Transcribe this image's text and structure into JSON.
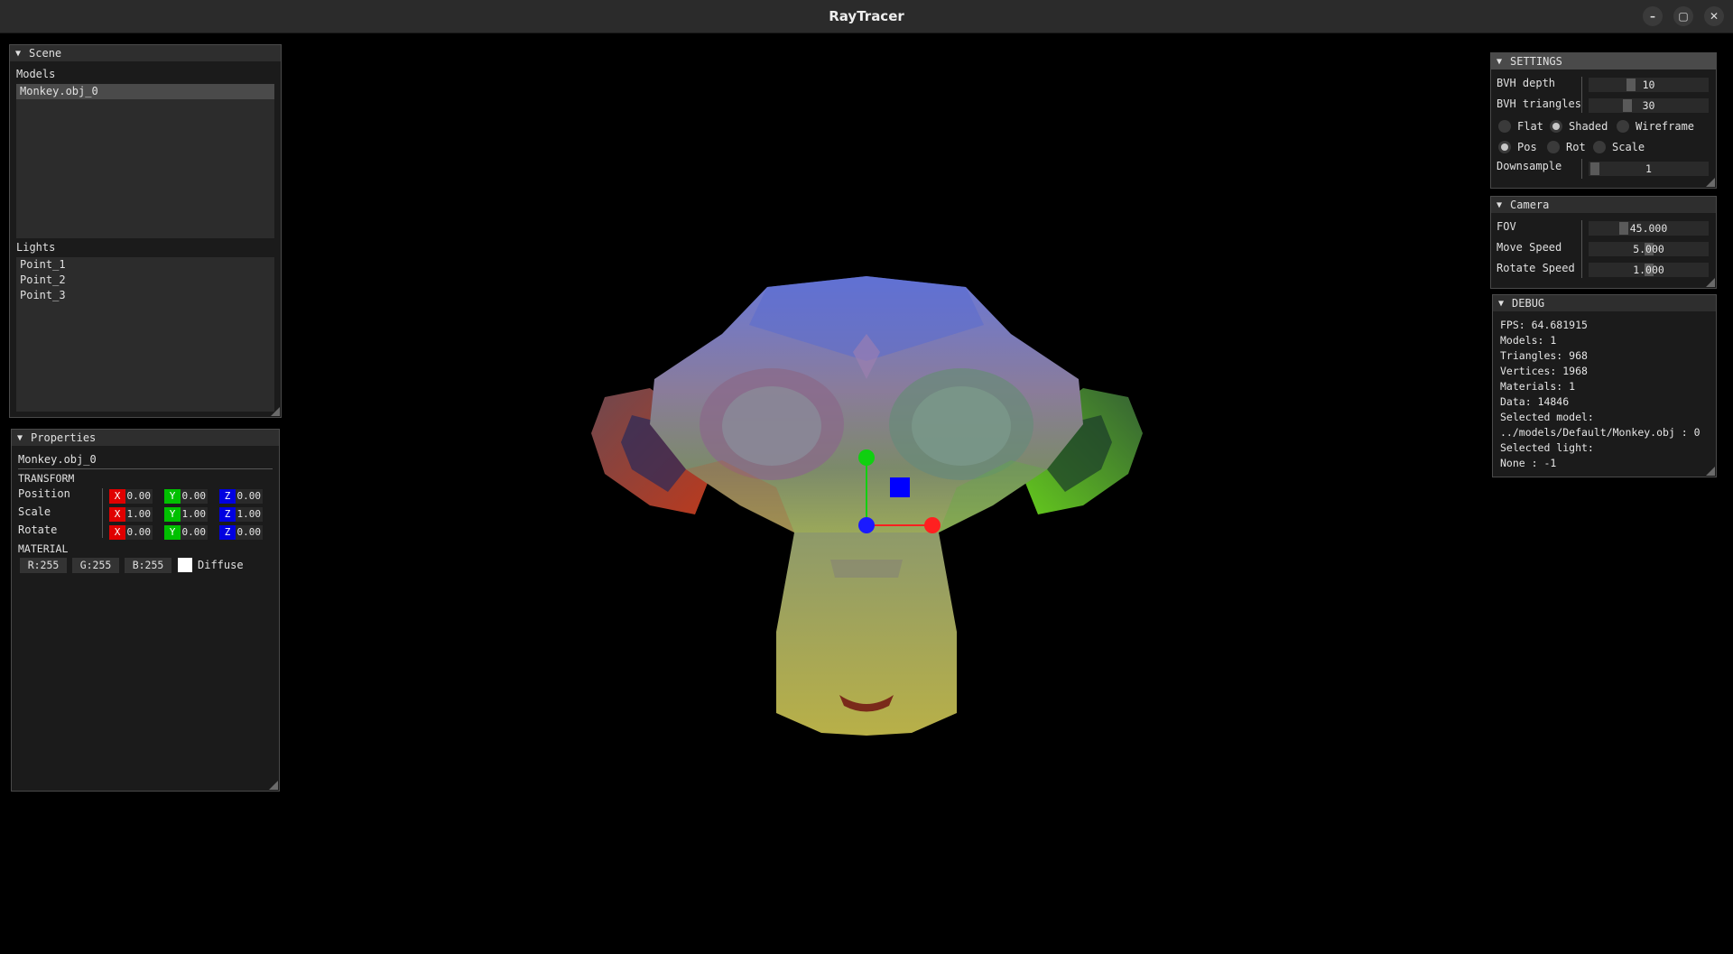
{
  "window": {
    "title": "RayTracer",
    "minimize": "–",
    "maximize": "▢",
    "close": "✕"
  },
  "scene_panel": {
    "title": "Scene",
    "models_label": "Models",
    "models": [
      "Monkey.obj_0"
    ],
    "lights_label": "Lights",
    "lights": [
      "Point_1",
      "Point_2",
      "Point_3"
    ]
  },
  "properties_panel": {
    "title": "Properties",
    "selected_name": "Monkey.obj_0",
    "transform_label": "TRANSFORM",
    "axis_labels": {
      "x": "X",
      "y": "Y",
      "z": "Z"
    },
    "position": {
      "label": "Position",
      "x": "0.00",
      "y": "0.00",
      "z": "0.00"
    },
    "scale": {
      "label": "Scale",
      "x": "1.00",
      "y": "1.00",
      "z": "1.00"
    },
    "rotate": {
      "label": "Rotate",
      "x": "0.00",
      "y": "0.00",
      "z": "0.00"
    },
    "material_label": "MATERIAL",
    "material": {
      "r": "R:255",
      "g": "G:255",
      "b": "B:255",
      "type": "Diffuse",
      "swatch_color": "#ffffff"
    }
  },
  "settings_panel": {
    "title": "SETTINGS",
    "bvh_depth": {
      "label": "BVH depth",
      "value": "10"
    },
    "bvh_triangles": {
      "label": "BVH triangles",
      "value": "30"
    },
    "render_modes": [
      {
        "label": "Flat",
        "selected": false
      },
      {
        "label": "Shaded",
        "selected": true
      },
      {
        "label": "Wireframe",
        "selected": false
      }
    ],
    "gizmo_modes": [
      {
        "label": "Pos",
        "selected": true
      },
      {
        "label": "Rot",
        "selected": false
      },
      {
        "label": "Scale",
        "selected": false
      }
    ],
    "downsample": {
      "label": "Downsample",
      "value": "1"
    }
  },
  "camera_panel": {
    "title": "Camera",
    "fov": {
      "label": "FOV",
      "value": "45.000"
    },
    "move_speed": {
      "label": "Move Speed",
      "value": "5.000"
    },
    "rotate_speed": {
      "label": "Rotate Speed",
      "value": "1.000"
    }
  },
  "debug_panel": {
    "title": "DEBUG",
    "fps": "FPS: 64.681915",
    "models": "Models: 1",
    "triangles": "Triangles: 968",
    "vertices": "Vertices: 1968",
    "materials": "Materials: 1",
    "data": "Data: 14846",
    "selected_model_label": "Selected model:",
    "selected_model_path": "../models/Default/Monkey.obj : 0",
    "selected_light_label": "Selected light:",
    "selected_light_value": "None : -1"
  },
  "colors": {
    "axis_x": "#e00000",
    "axis_y": "#00c000",
    "axis_z": "#0000e0",
    "gizmo_x": "#ff2020",
    "gizmo_y": "#10d010",
    "gizmo_z": "#1a1aff",
    "gizmo_center": "#0000ff"
  }
}
